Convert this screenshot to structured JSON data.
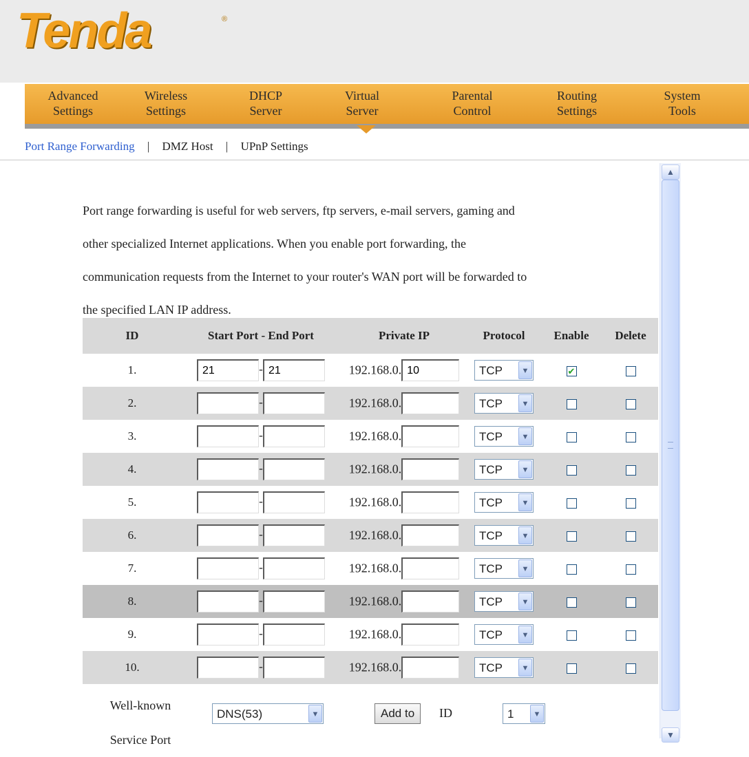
{
  "brand": {
    "logo_text": "Tenda",
    "registered_mark": "®"
  },
  "nav": {
    "items": [
      {
        "line1": "Advanced",
        "line2": "Settings"
      },
      {
        "line1": "Wireless",
        "line2": "Settings"
      },
      {
        "line1": "DHCP",
        "line2": "Server"
      },
      {
        "line1": "Virtual",
        "line2": "Server"
      },
      {
        "line1": "Parental",
        "line2": "Control"
      },
      {
        "line1": "Routing",
        "line2": "Settings"
      },
      {
        "line1": "System",
        "line2": "Tools"
      }
    ],
    "active_index": 3
  },
  "subnav": {
    "items": [
      "Port Range Forwarding",
      "DMZ Host",
      "UPnP Settings"
    ],
    "separator": "|"
  },
  "intro": {
    "lines": [
      " Port range forwarding is useful for web servers, ftp servers, e-mail servers, gaming and",
      "other specialized Internet applications. When you enable port forwarding, the",
      "communication requests from the Internet to your router's WAN port will be forwarded to",
      "the specified LAN IP address."
    ]
  },
  "table": {
    "headers": {
      "id": "ID",
      "ports": "Start Port - End Port",
      "private_ip": "Private IP",
      "protocol": "Protocol",
      "enable": "Enable",
      "delete": "Delete"
    },
    "ip_prefix": "192.168.0.",
    "port_separator": "-",
    "rows": [
      {
        "id": "1.",
        "start": "21",
        "end": "21",
        "ip_suffix": "10",
        "protocol": "TCP",
        "enabled": true,
        "delete": false
      },
      {
        "id": "2.",
        "start": "",
        "end": "",
        "ip_suffix": "",
        "protocol": "TCP",
        "enabled": false,
        "delete": false
      },
      {
        "id": "3.",
        "start": "",
        "end": "",
        "ip_suffix": "",
        "protocol": "TCP",
        "enabled": false,
        "delete": false
      },
      {
        "id": "4.",
        "start": "",
        "end": "",
        "ip_suffix": "",
        "protocol": "TCP",
        "enabled": false,
        "delete": false
      },
      {
        "id": "5.",
        "start": "",
        "end": "",
        "ip_suffix": "",
        "protocol": "TCP",
        "enabled": false,
        "delete": false
      },
      {
        "id": "6.",
        "start": "",
        "end": "",
        "ip_suffix": "",
        "protocol": "TCP",
        "enabled": false,
        "delete": false
      },
      {
        "id": "7.",
        "start": "",
        "end": "",
        "ip_suffix": "",
        "protocol": "TCP",
        "enabled": false,
        "delete": false
      },
      {
        "id": "8.",
        "start": "",
        "end": "",
        "ip_suffix": "",
        "protocol": "TCP",
        "enabled": false,
        "delete": false
      },
      {
        "id": "9.",
        "start": "",
        "end": "",
        "ip_suffix": "",
        "protocol": "TCP",
        "enabled": false,
        "delete": false
      },
      {
        "id": "10.",
        "start": "",
        "end": "",
        "ip_suffix": "",
        "protocol": "TCP",
        "enabled": false,
        "delete": false
      }
    ]
  },
  "well_known": {
    "label_line1": "Well-known",
    "label_line2": "Service Port",
    "service_selected": "DNS(53)",
    "add_button": "Add to",
    "id_label": "ID",
    "id_selected": "1"
  },
  "colors": {
    "nav_orange": "#e69a2a",
    "logo_orange": "#f0a020",
    "active_link": "#2e5fcf",
    "row_gray": "#d9d9d9",
    "check_green": "#21a121"
  }
}
